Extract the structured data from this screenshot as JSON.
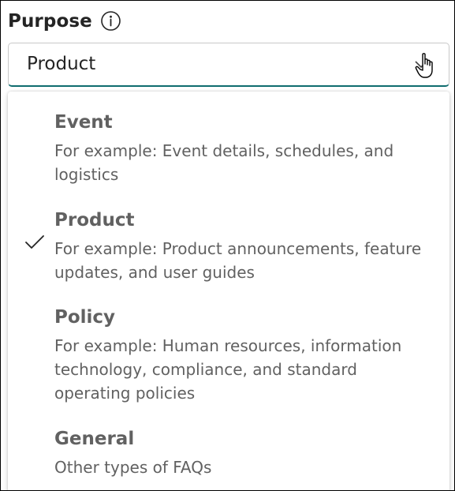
{
  "field": {
    "label": "Purpose",
    "info_icon": "info-icon",
    "selected_value": "Product"
  },
  "options": [
    {
      "title": "Event",
      "description": "For example: Event details, schedules, and logistics",
      "selected": false
    },
    {
      "title": "Product",
      "description": "For example: Product announcements, feature updates, and user guides",
      "selected": true
    },
    {
      "title": "Policy",
      "description": "For example: Human resources, information technology, compliance, and standard operating policies",
      "selected": false
    },
    {
      "title": "General",
      "description": "Other types of FAQs",
      "selected": false
    }
  ],
  "colors": {
    "accent": "#0f6c6f",
    "text": "#242424",
    "muted": "#616161"
  }
}
